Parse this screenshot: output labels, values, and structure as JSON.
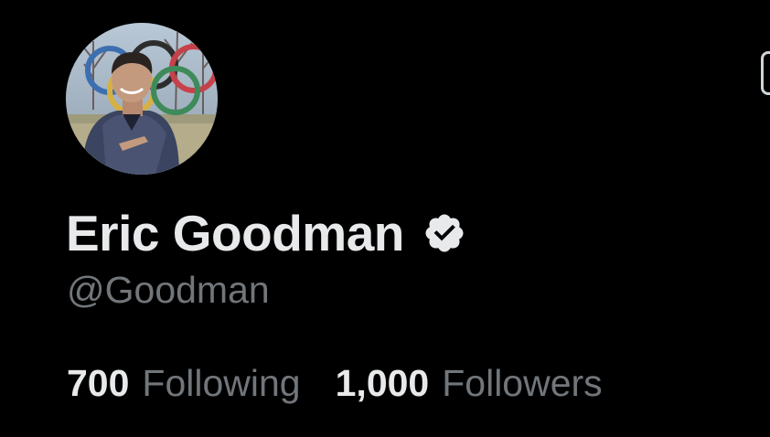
{
  "profile": {
    "display_name": "Eric Goodman",
    "handle": "@Goodman",
    "verified_icon": "verified-badge-icon",
    "avatar": "profile-photo"
  },
  "stats": {
    "following_count": "700",
    "following_label": "Following",
    "followers_count": "1,000",
    "followers_label": "Followers"
  },
  "colors": {
    "background": "#000000",
    "primary_text": "#e7e9ea",
    "secondary_text": "#71767b"
  }
}
